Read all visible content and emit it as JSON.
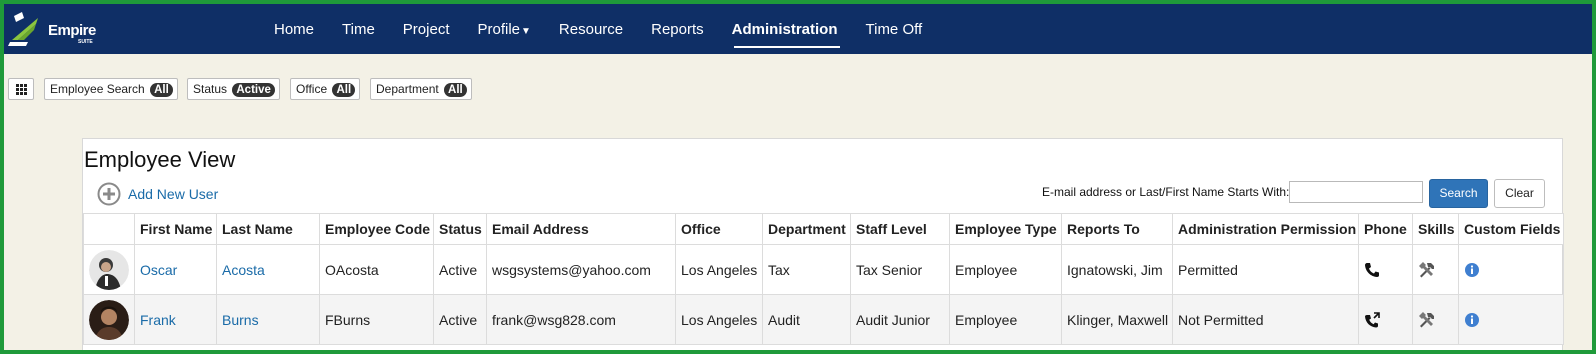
{
  "app": {
    "logo_text": "Empire",
    "logo_sub": "SUITE"
  },
  "nav": {
    "items": [
      {
        "label": "Home"
      },
      {
        "label": "Time"
      },
      {
        "label": "Project"
      },
      {
        "label": "Profile"
      },
      {
        "label": "Resource"
      },
      {
        "label": "Reports"
      },
      {
        "label": "Administration"
      },
      {
        "label": "Time Off"
      }
    ],
    "active": "Administration"
  },
  "filters": {
    "employee_search": {
      "label": "Employee Search",
      "value": "All"
    },
    "status": {
      "label": "Status",
      "value": "Active"
    },
    "office": {
      "label": "Office",
      "value": "All"
    },
    "department": {
      "label": "Department",
      "value": "All"
    }
  },
  "panel": {
    "title": "Employee View",
    "add_user_label": "Add New User",
    "search_label": "E-mail address or Last/First Name Starts With:",
    "search_value": "",
    "search_button": "Search",
    "clear_button": "Clear"
  },
  "table": {
    "columns": [
      "",
      "First Name",
      "Last Name",
      "Employee Code",
      "Status",
      "Email Address",
      "Office",
      "Department",
      "Staff Level",
      "Employee Type",
      "Reports To",
      "Administration Permission",
      "Phone",
      "Skills",
      "Custom Fields"
    ],
    "rows": [
      {
        "first_name": "Oscar",
        "last_name": "Acosta",
        "code": "OAcosta",
        "status": "Active",
        "email": "wsgsystems@yahoo.com",
        "office": "Los Angeles",
        "department": "Tax",
        "staff_level": "Tax Senior",
        "employee_type": "Employee",
        "reports_to": "Ignatowski, Jim",
        "permission": "Permitted",
        "phone_icon": "phone-icon",
        "skills_icon": "tools-icon",
        "custom_icon": "info-icon"
      },
      {
        "first_name": "Frank",
        "last_name": "Burns",
        "code": "FBurns",
        "status": "Active",
        "email": "frank@wsg828.com",
        "office": "Los Angeles",
        "department": "Audit",
        "staff_level": "Audit Junior",
        "employee_type": "Employee",
        "reports_to": "Klinger, Maxwell",
        "permission": "Not Permitted",
        "phone_icon": "phone-forward-icon",
        "skills_icon": "tools-icon",
        "custom_icon": "info-icon"
      }
    ]
  },
  "colors": {
    "nav_bg": "#0f2f66",
    "link": "#1a6ba8",
    "search_button": "#2f74b8",
    "frame": "#1f9a3a",
    "page_bg": "#f3f1e6"
  }
}
